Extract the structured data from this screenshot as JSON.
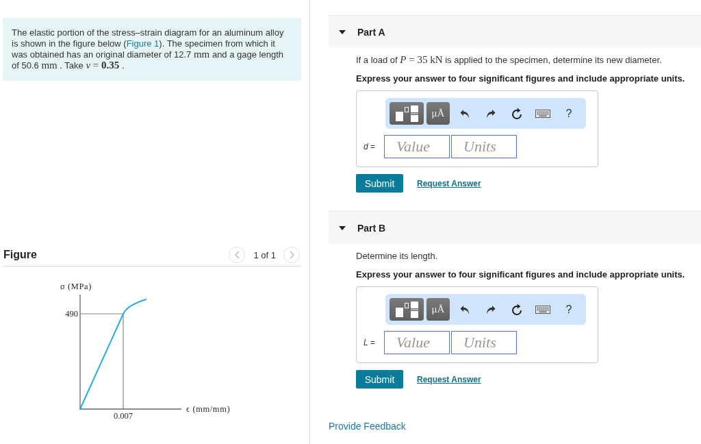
{
  "problem": {
    "segments": [
      {
        "kind": "text",
        "text": "The elastic portion of the stress–strain diagram for an aluminum alloy is shown in the figure below ("
      },
      {
        "kind": "link",
        "text": "Figure 1"
      },
      {
        "kind": "text",
        "text": "). The specimen from which it was obtained has an original diameter of 12.7 "
      },
      {
        "kind": "math",
        "text": "mm"
      },
      {
        "kind": "text",
        "text": " and a gage length of 50.6 "
      },
      {
        "kind": "math",
        "text": "mm"
      },
      {
        "kind": "text",
        "text": " . Take "
      },
      {
        "kind": "math",
        "text": "*v* = **0.35**"
      },
      {
        "kind": "text",
        "text": " ."
      }
    ]
  },
  "figure": {
    "title": "Figure",
    "pager": {
      "previous": {
        "disabled": true
      },
      "label": "1 of 1",
      "next": {
        "disabled": true
      }
    },
    "diagram": {
      "y_axis_title": "σ (MPa)",
      "x_axis_title": "ϵ (mm/mm)",
      "y_mark": "490",
      "x_mark": "0.007"
    }
  },
  "parts": [
    {
      "title": "Part A",
      "expanded": true,
      "question": [
        {
          "kind": "text",
          "text": "If a load of "
        },
        {
          "kind": "math",
          "text": "*P* = 35 kN"
        },
        {
          "kind": "text",
          "text": " is applied to the specimen, determine its new diameter."
        }
      ],
      "instruction": "Express your answer to four significant figures and include appropriate units.",
      "answer": {
        "label": "*d* =",
        "toolbar": [
          {
            "kind": "templates"
          },
          {
            "kind": "symbols",
            "label": "μÅ"
          },
          {
            "kind": "undo"
          },
          {
            "kind": "redo"
          },
          {
            "kind": "reset"
          },
          {
            "kind": "keyboard"
          },
          {
            "kind": "help",
            "label": "?"
          }
        ],
        "value_field": {
          "placeholder": "Value"
        },
        "units_field": {
          "placeholder": "Units"
        }
      },
      "submit": "Submit",
      "request": "Request Answer"
    },
    {
      "title": "Part B",
      "expanded": true,
      "question": [
        {
          "kind": "text",
          "text": "Determine its length."
        }
      ],
      "instruction": "Express your answer to four significant figures and include appropriate units.",
      "answer": {
        "label": "*L* =",
        "toolbar": [
          {
            "kind": "templates"
          },
          {
            "kind": "symbols",
            "label": "μÅ"
          },
          {
            "kind": "undo"
          },
          {
            "kind": "redo"
          },
          {
            "kind": "reset"
          },
          {
            "kind": "keyboard"
          },
          {
            "kind": "help",
            "label": "?"
          }
        ],
        "value_field": {
          "placeholder": "Value"
        },
        "units_field": {
          "placeholder": "Units"
        }
      },
      "submit": "Submit",
      "request": "Request Answer"
    }
  ],
  "feedback_link": "Provide Feedback"
}
